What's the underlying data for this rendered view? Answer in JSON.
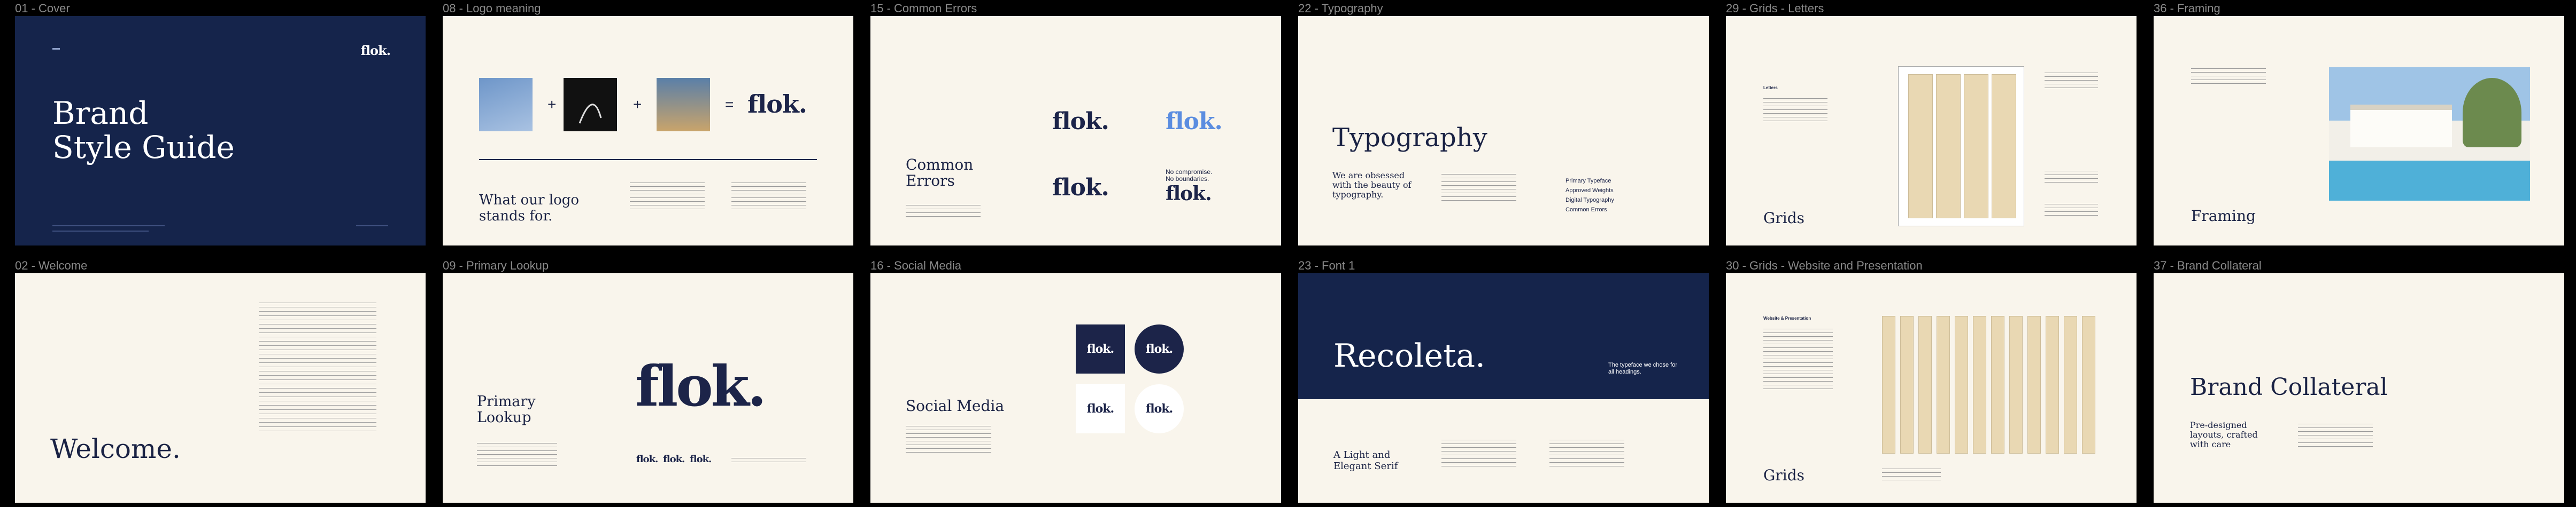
{
  "frames": {
    "f01": "01 - Cover",
    "f08": "08 - Logo meaning",
    "f15": "15 - Common Errors",
    "f22": "22 - Typography",
    "f29": "29 - Grids - Letters",
    "f36": "36 - Framing",
    "f02": "02 - Welcome",
    "f09": "09 - Primary Lookup",
    "f16": "16 - Social Media",
    "f23": "23 - Font 1",
    "f30": "30 - Grids - Website and Presentation",
    "f37": "37 - Brand Collateral"
  },
  "brand": {
    "logo": "flok."
  },
  "cover": {
    "title_line1": "Brand",
    "title_line2": "Style Guide"
  },
  "logo_meaning": {
    "heading": "What our logo stands for.",
    "plus": "+",
    "equals": "="
  },
  "common_errors": {
    "heading": "Common Errors",
    "label_compromise": "No compromise.",
    "label_boundaries": "No boundaries."
  },
  "typography": {
    "title": "Typography",
    "subtitle": "We are obsessed with the beauty of typography.",
    "list": [
      "Primary Typeface",
      "Approved Weights",
      "Digital Typography",
      "Common Errors"
    ]
  },
  "grids_letters": {
    "label": "Letters",
    "heading": "Grids"
  },
  "framing": {
    "heading": "Framing"
  },
  "welcome": {
    "heading": "Welcome."
  },
  "primary_lookup": {
    "heading": "Primary Lookup"
  },
  "social": {
    "heading": "Social Media"
  },
  "font1": {
    "name": "Recoleta.",
    "tagline": "The typeface we chose for all headings.",
    "heading": "A Light and Elegant Serif"
  },
  "grids_web": {
    "label": "Website & Presentation",
    "heading": "Grids"
  },
  "collateral": {
    "heading": "Brand Collateral",
    "sub": "Pre-designed layouts, crafted with care"
  },
  "colors": {
    "navy": "#15244b",
    "cream": "#f9f5ec",
    "blue_logo": "#5b8de0",
    "grid": "#e9d8b3"
  }
}
